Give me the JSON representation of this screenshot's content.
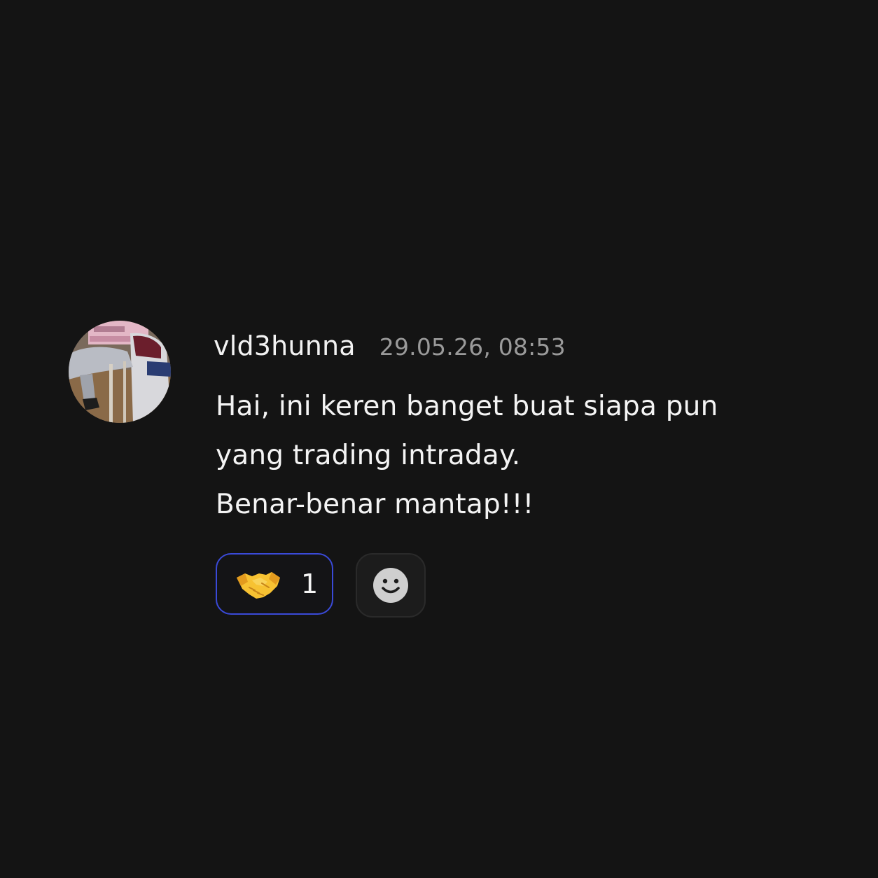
{
  "message": {
    "username": "vld3hunna",
    "timestamp": "29.05.26, 08:53",
    "lines": [
      "Hai, ini keren banget buat siapa pun",
      "yang trading intraday.",
      "Benar-benar mantap!!!"
    ],
    "reactions": [
      {
        "icon": "handshake-emoji",
        "count": "1",
        "selected": true
      }
    ],
    "add_reaction_icon": "smiley-face-icon"
  },
  "colors": {
    "background": "#141414",
    "text": "#f4f4f4",
    "timestamp": "#9a9a9a",
    "selected_reaction_border": "#3a4ad8"
  }
}
